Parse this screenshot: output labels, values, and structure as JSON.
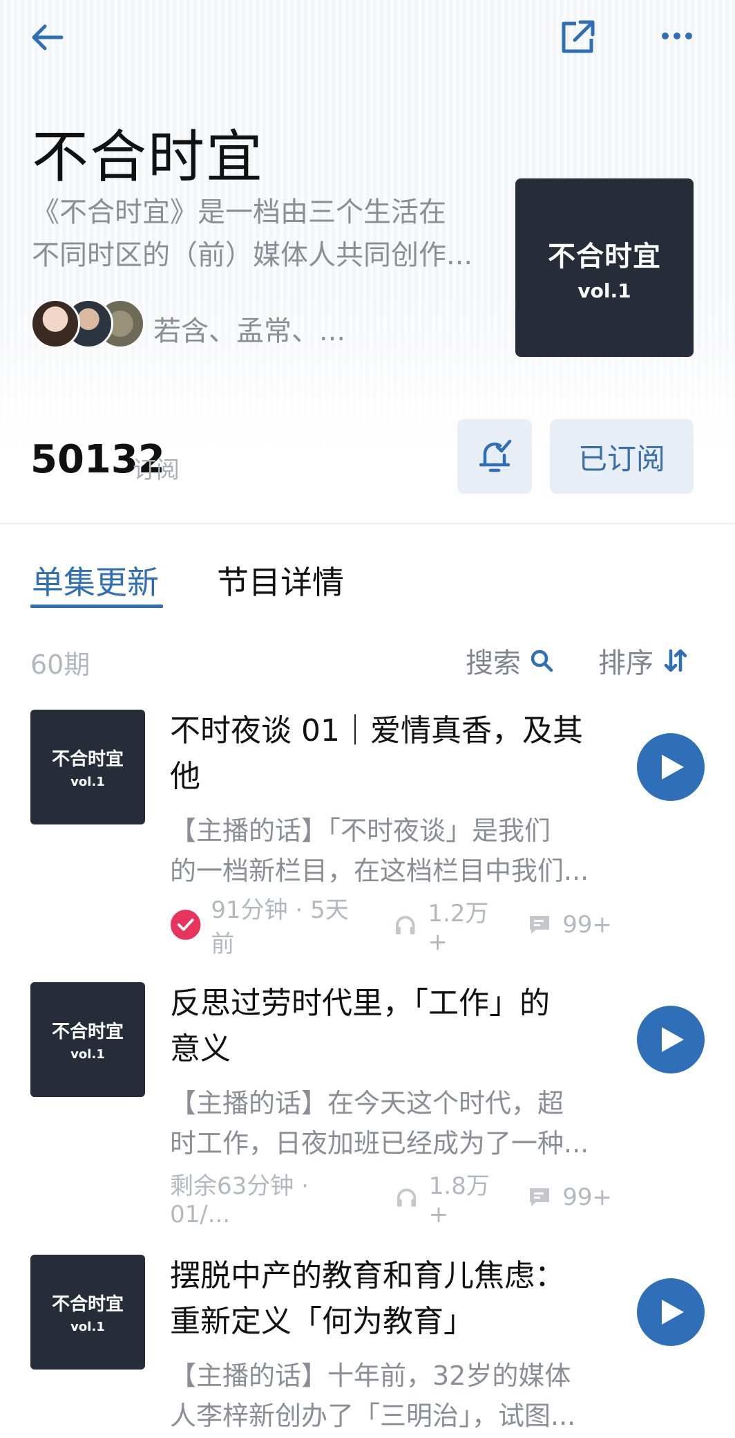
{
  "podcast": {
    "title": "不合时宜",
    "description_lines": [
      "《不合时宜》是一档由三个生活在",
      "不同时区的（前）媒体人共同创作..."
    ],
    "hosts": "若含、孟常、...",
    "cover_logo": "不合时宜",
    "cover_vol": "vol.1"
  },
  "stats": {
    "subscribers": "50132",
    "subscribers_label": "订阅"
  },
  "actions": {
    "subscribed_label": "已订阅"
  },
  "tabs": [
    {
      "label": "单集更新",
      "active": true
    },
    {
      "label": "节目详情",
      "active": false
    }
  ],
  "episode_count": "60期",
  "toolbar": {
    "search_label": "搜索",
    "sort_label": "排序"
  },
  "episodes": [
    {
      "title_lines": [
        "不时夜谈 01｜爱情真香，及其",
        "他"
      ],
      "desc_lines": [
        "【主播的话】「不时夜谈」是我们",
        "的一档新栏目，在这档栏目中我们..."
      ],
      "meta": "91分钟 · 5天前",
      "plays": "1.2万+",
      "comments": "99+",
      "completed": true
    },
    {
      "title_lines": [
        "反思过劳时代里，「工作」的",
        "意义"
      ],
      "desc_lines": [
        "【主播的话】在今天这个时代，超",
        "时工作，日夜加班已经成为了一种..."
      ],
      "meta": "剩余63分钟 · 01/...",
      "plays": "1.8万+",
      "comments": "99+",
      "completed": false
    },
    {
      "title_lines": [
        "摆脱中产的教育和育儿焦虑：",
        "重新定义「何为教育」"
      ],
      "desc_lines": [
        "【主播的话】十年前，32岁的媒体",
        "人李梓新创办了「三明治」，试图..."
      ]
    }
  ],
  "colors": {
    "accent": "#2f6fb7",
    "cover_bg": "#262d39",
    "completed": "#e8345c"
  },
  "icons": [
    "back-arrow-icon",
    "share-icon",
    "more-icon",
    "bell-check-icon",
    "search-icon",
    "sort-icon",
    "play-icon",
    "check-circle-icon",
    "headphones-icon",
    "comment-icon"
  ]
}
